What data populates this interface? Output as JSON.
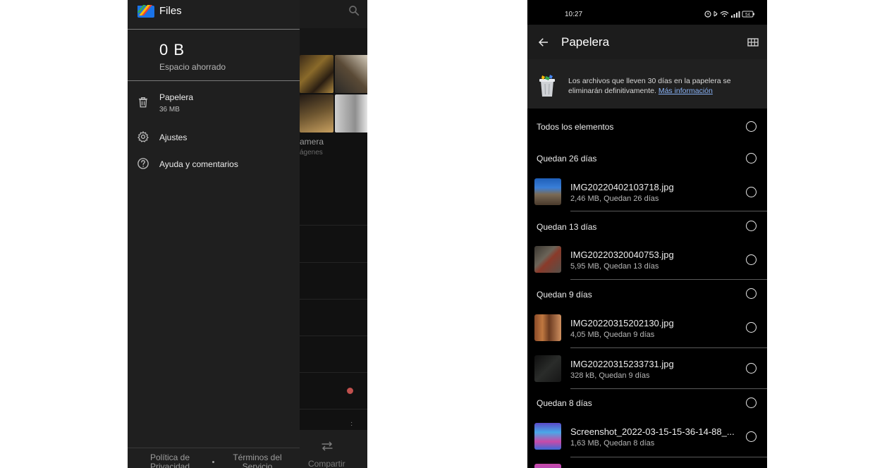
{
  "left_phone": {
    "background": {
      "camera_label": "amera",
      "images_label": "ágenes",
      "share_label": "Compartir"
    },
    "drawer": {
      "app_title": "Files",
      "saved_amount": "0 B",
      "saved_label": "Espacio ahorrado",
      "items": [
        {
          "label": "Papelera",
          "sub": "36 MB",
          "icon": "trash-icon"
        },
        {
          "label": "Ajustes",
          "icon": "gear-icon"
        },
        {
          "label": "Ayuda y comentarios",
          "icon": "help-icon"
        }
      ],
      "footer": {
        "privacy": "Política de Privacidad",
        "terms": "Términos del Servicio"
      }
    }
  },
  "right_phone": {
    "status_bar": {
      "time": "10:27",
      "battery": "54"
    },
    "title": "Papelera",
    "banner": {
      "text": "Los archivos que lleven 30 días en la papelera se eliminarán definitivamente.",
      "link": "Más información"
    },
    "select_all_label": "Todos los elementos",
    "groups": [
      {
        "label": "Quedan 26 días",
        "files": [
          {
            "name": "IMG20220402103718.jpg",
            "meta": "2,46 MB, Quedan 26 días"
          }
        ]
      },
      {
        "label": "Quedan 13 días",
        "files": [
          {
            "name": "IMG20220320040753.jpg",
            "meta": "5,95 MB, Quedan 13 días"
          }
        ]
      },
      {
        "label": "Quedan 9 días",
        "files": [
          {
            "name": "IMG20220315202130.jpg",
            "meta": "4,05 MB, Quedan 9 días"
          },
          {
            "name": "IMG20220315233731.jpg",
            "meta": "328 kB, Quedan 9 días"
          }
        ]
      },
      {
        "label": "Quedan 8 días",
        "files": [
          {
            "name": "Screenshot_2022-03-15-15-36-14-88_...",
            "meta": "1,63 MB, Quedan 8 días"
          }
        ]
      }
    ],
    "colors": {
      "link": "#8ab4f8",
      "background": "#000000",
      "appbar": "#1c1c1c"
    }
  }
}
